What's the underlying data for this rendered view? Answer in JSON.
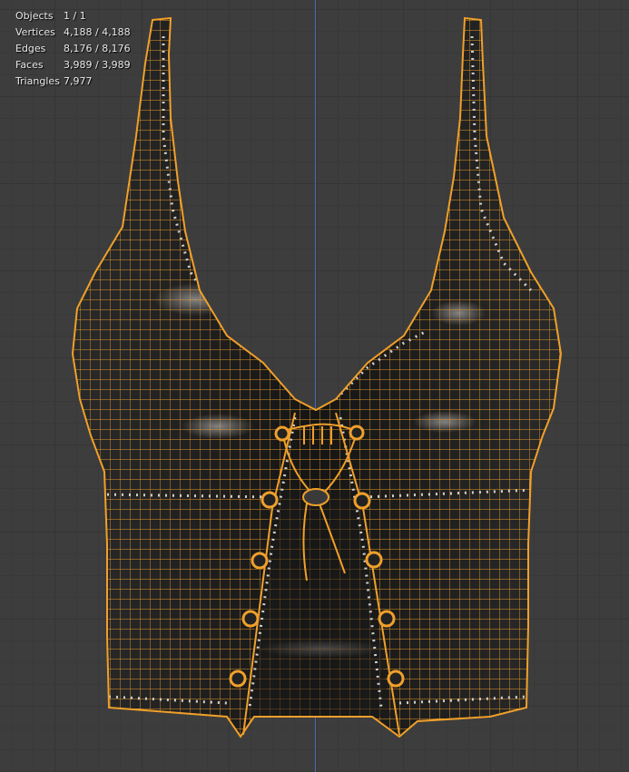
{
  "stats": {
    "rows": [
      {
        "label": "Objects",
        "value": "1 / 1"
      },
      {
        "label": "Vertices",
        "value": "4,188 / 4,188"
      },
      {
        "label": "Edges",
        "value": "8,176 / 8,176"
      },
      {
        "label": "Faces",
        "value": "3,989 / 3,989"
      },
      {
        "label": "Triangles",
        "value": "7,977"
      }
    ]
  },
  "colors": {
    "background": "#3d3d3d",
    "grid": "#353535",
    "axis": "#4d6cb3",
    "wire_selected": "#f0a02a",
    "mesh_shade": "#1e1e1e"
  }
}
